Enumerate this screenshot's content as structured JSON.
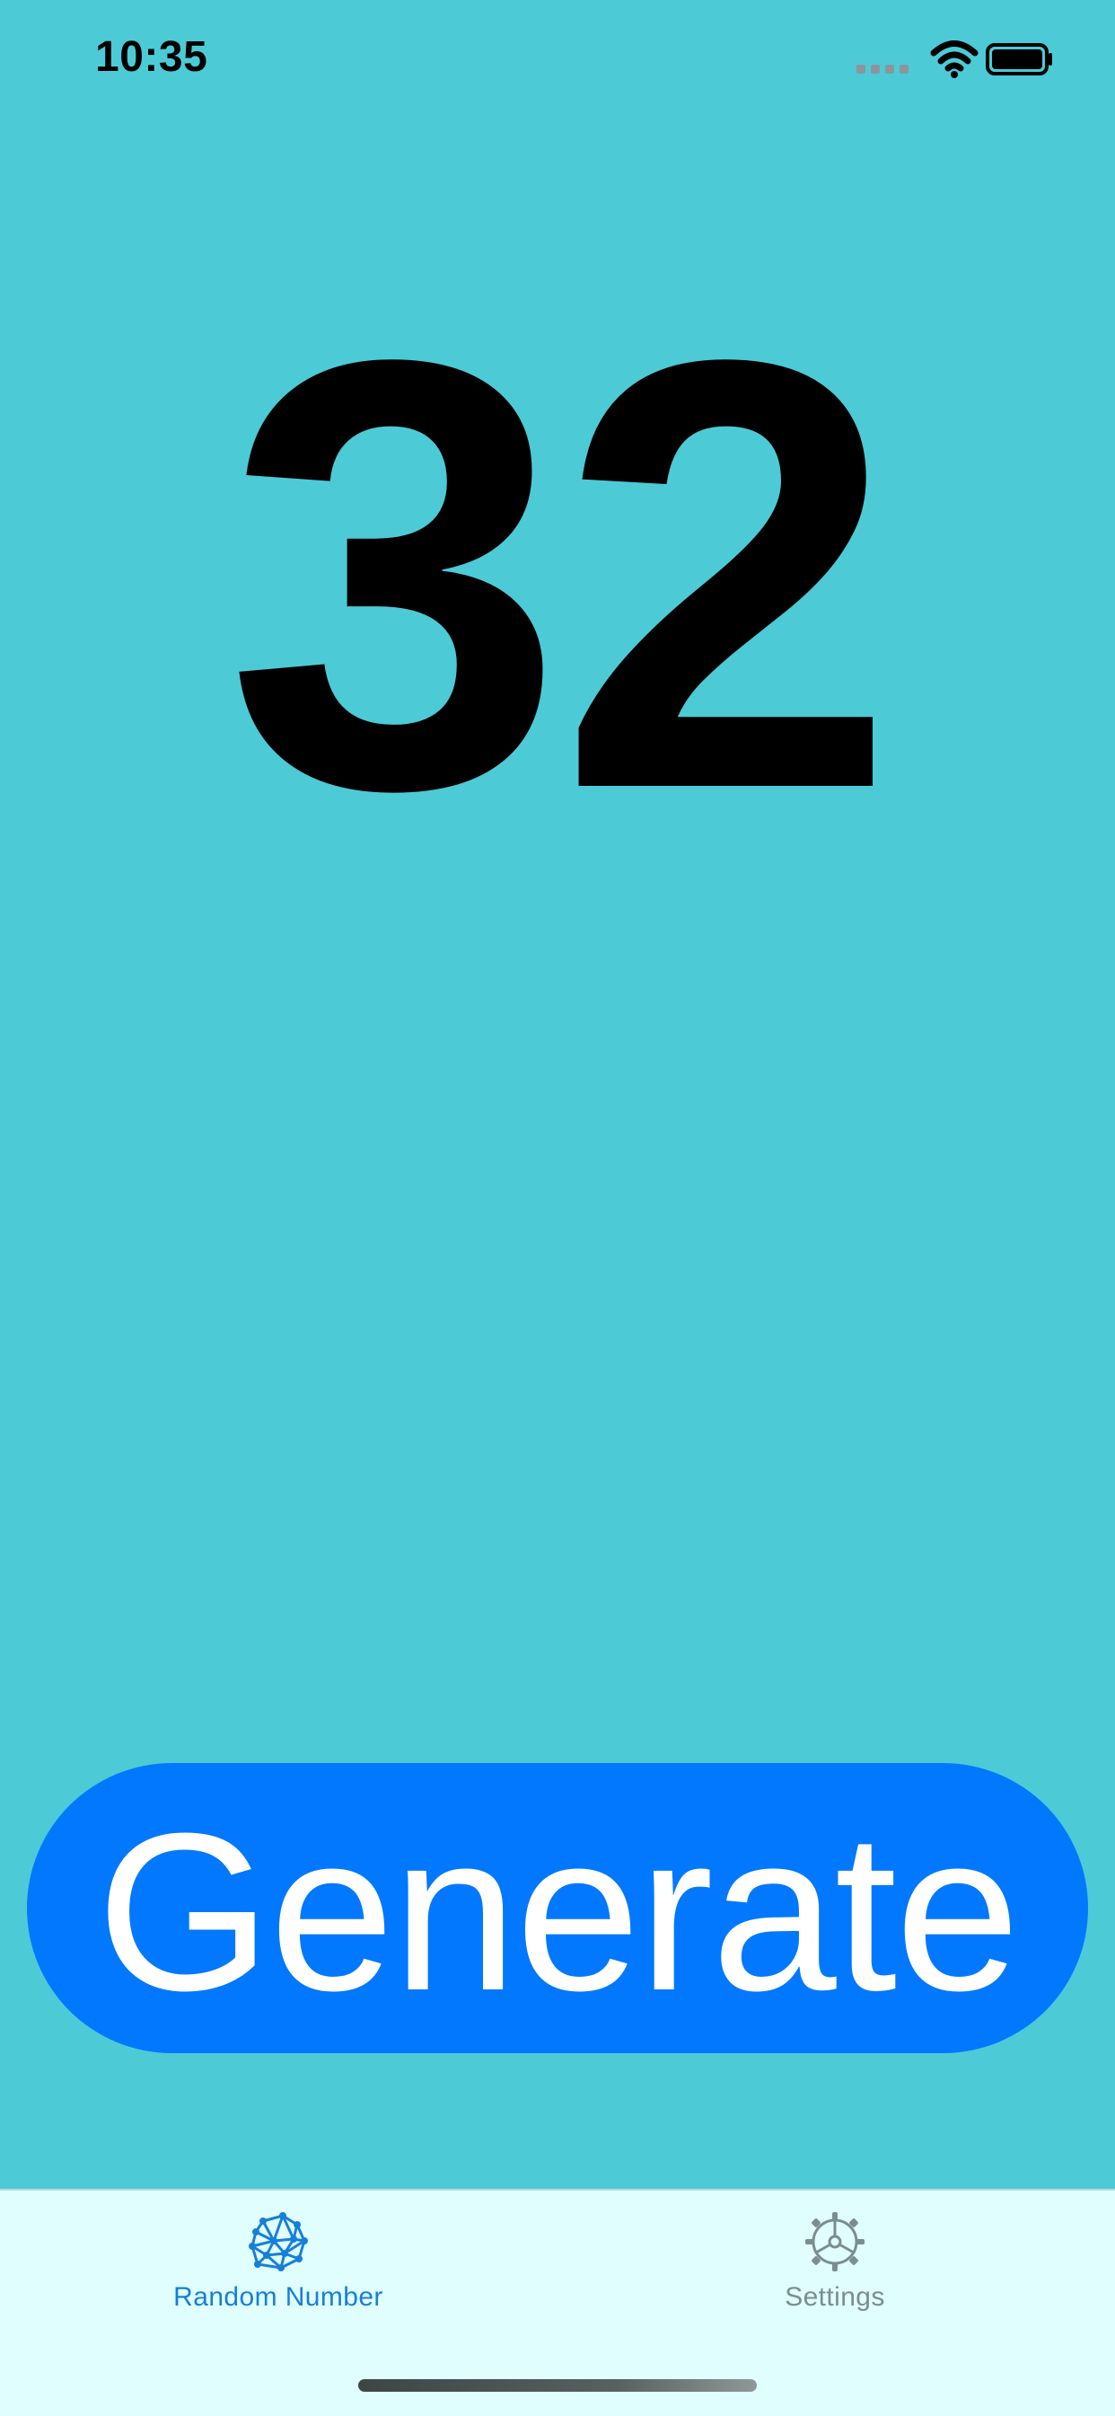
{
  "status_bar": {
    "time": "10:35"
  },
  "main": {
    "number": "32",
    "generate_label": "Generate"
  },
  "tabs": [
    {
      "label": "Random Number",
      "icon": "network-icon",
      "active": true,
      "color": "#167fd8"
    },
    {
      "label": "Settings",
      "icon": "gear-icon",
      "active": false,
      "color": "#7c8d92"
    }
  ],
  "colors": {
    "background": "#4ccbd6",
    "button": "#0178fe",
    "tab_bar": "#e0fefe",
    "active_tab": "#167fd8",
    "inactive_tab": "#7c8d92"
  }
}
